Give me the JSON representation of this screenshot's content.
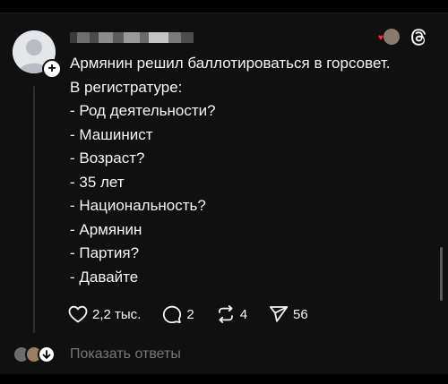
{
  "post": {
    "lines": [
      "Армянин решил баллотироваться в горсовет.",
      "В регистратуре:",
      "- Род деятельности?",
      "- Машинист",
      "- Возраст?",
      "- 35 лет",
      "- Национальность?",
      "- Армянин",
      "- Партия?",
      "- Давайте"
    ]
  },
  "actions": {
    "likes": "2,2 тыс.",
    "replies": "2",
    "reposts": "4",
    "shares": "56"
  },
  "footer": {
    "show_replies": "Показать ответы"
  },
  "colors": {
    "background": "#101010",
    "text": "#f3f5f7",
    "muted": "#777777",
    "heart": "#ff3040"
  },
  "icons": [
    "plus-icon",
    "threads-logo-icon",
    "heart-icon",
    "comment-icon",
    "repost-icon",
    "share-icon",
    "arrow-down-icon"
  ]
}
